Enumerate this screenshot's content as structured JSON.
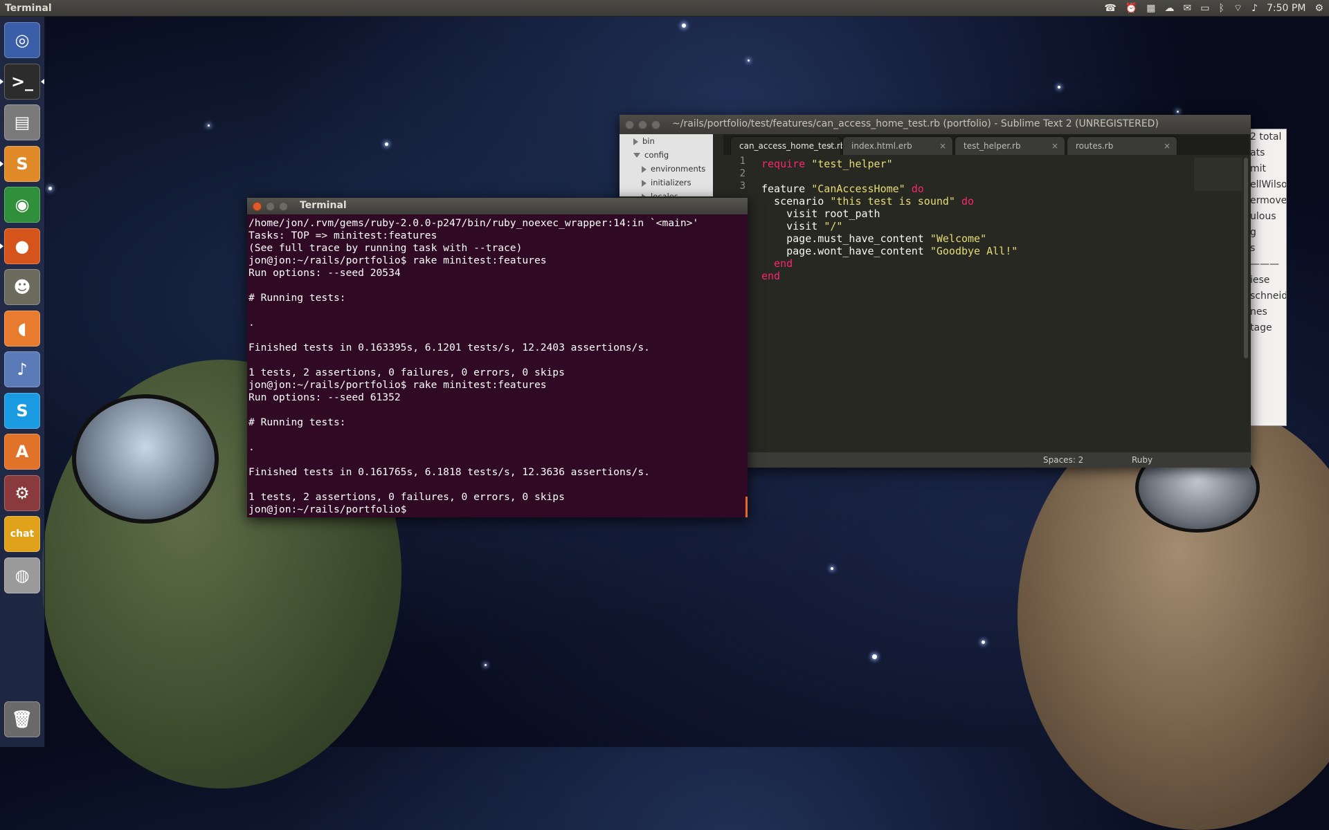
{
  "top_panel": {
    "title": "Terminal",
    "clock": "7:50 PM",
    "indicators": [
      "phone-icon",
      "alarm-icon",
      "keyboard-icon",
      "cloud-icon",
      "mail-icon",
      "battery-icon",
      "bluetooth-icon",
      "wifi-icon",
      "volume-icon",
      "gear-icon"
    ]
  },
  "launcher": {
    "items": [
      {
        "name": "ubuntu-dash-icon",
        "glyph": "◎",
        "color": "#3b5ea8"
      },
      {
        "name": "terminal-icon",
        "glyph": ">_",
        "color": "#2c2c2c"
      },
      {
        "name": "file-manager-icon",
        "glyph": "▤",
        "color": "#7a7a7a"
      },
      {
        "name": "sublime-text-icon",
        "glyph": "S",
        "color": "#e08a2a"
      },
      {
        "name": "chrome-icon",
        "glyph": "◉",
        "color": "#2f8f3a"
      },
      {
        "name": "firefox-icon",
        "glyph": "●",
        "color": "#d5541c"
      },
      {
        "name": "gimp-icon",
        "glyph": "☻",
        "color": "#6d6b5e"
      },
      {
        "name": "mango-icon",
        "glyph": "◖",
        "color": "#e87b2e"
      },
      {
        "name": "rhythmbox-icon",
        "glyph": "♪",
        "color": "#5a7ab8"
      },
      {
        "name": "skype-icon",
        "glyph": "S",
        "color": "#1a9ae0"
      },
      {
        "name": "software-center-icon",
        "glyph": "A",
        "color": "#e0722a"
      },
      {
        "name": "system-settings-icon",
        "glyph": "⚙",
        "color": "#8a3a3a"
      },
      {
        "name": "chat-icon",
        "glyph": "chat",
        "color": "#e0a21a"
      },
      {
        "name": "hdd-icon",
        "glyph": "◍",
        "color": "#9a9a9a"
      },
      {
        "name": "trash-icon",
        "glyph": "🗑",
        "color": "#6a6a6a"
      }
    ]
  },
  "sublime": {
    "title": "~/rails/portfolio/test/features/can_access_home_test.rb (portfolio) - Sublime Text 2 (UNREGISTERED)",
    "sidebar": [
      {
        "label": "bin",
        "indent": 0,
        "open": false
      },
      {
        "label": "config",
        "indent": 0,
        "open": true
      },
      {
        "label": "environments",
        "indent": 1,
        "open": false
      },
      {
        "label": "initializers",
        "indent": 1,
        "open": false
      },
      {
        "label": "locales",
        "indent": 1,
        "open": false
      }
    ],
    "tabs": [
      "can_access_home_test.rb",
      "index.html.erb",
      "test_helper.rb",
      "routes.rb"
    ],
    "line_numbers": [
      "1",
      "2",
      "3"
    ],
    "code": [
      {
        "k1": "require",
        "s": " \"test_helper\"",
        "k2": ""
      },
      {
        "k1": "",
        "s": "",
        "k2": ""
      },
      {
        "pre": "feature ",
        "s": "\"CanAccessHome\"",
        "k2": " do"
      },
      {
        "pre": "  scenario ",
        "s": "\"this test is sound\"",
        "k2": " do"
      },
      {
        "pre": "    visit root_path",
        "s": "",
        "k2": ""
      },
      {
        "pre": "    visit ",
        "s": "\"/\"",
        "k2": ""
      },
      {
        "pre": "    page.must_have_content ",
        "s": "\"Welcome\"",
        "k2": ""
      },
      {
        "pre": "    page.wont_have_content ",
        "s": "\"Goodbye All!\"",
        "k2": ""
      },
      {
        "k2i": "  end"
      },
      {
        "k2i": "end"
      }
    ],
    "status": {
      "spaces": "Spaces: 2",
      "syntax": "Ruby"
    }
  },
  "background_window": {
    "lines": [
      "2 total",
      "ats",
      "mit",
      "ellWilso",
      "ermove",
      "ulous",
      "g",
      "s",
      "———",
      "iese",
      "schneid",
      "nes",
      "tage"
    ]
  },
  "terminal": {
    "title": "Terminal",
    "lines": [
      "/home/jon/.rvm/gems/ruby-2.0.0-p247/bin/ruby_noexec_wrapper:14:in `<main>'",
      "Tasks: TOP => minitest:features",
      "(See full trace by running task with --trace)",
      "jon@jon:~/rails/portfolio$ rake minitest:features",
      "Run options: --seed 20534",
      "",
      "# Running tests:",
      "",
      ".",
      "",
      "Finished tests in 0.163395s, 6.1201 tests/s, 12.2403 assertions/s.",
      "",
      "1 tests, 2 assertions, 0 failures, 0 errors, 0 skips",
      "jon@jon:~/rails/portfolio$ rake minitest:features",
      "Run options: --seed 61352",
      "",
      "# Running tests:",
      "",
      ".",
      "",
      "Finished tests in 0.161765s, 6.1818 tests/s, 12.3636 assertions/s.",
      "",
      "1 tests, 2 assertions, 0 failures, 0 errors, 0 skips",
      "jon@jon:~/rails/portfolio$ "
    ]
  }
}
